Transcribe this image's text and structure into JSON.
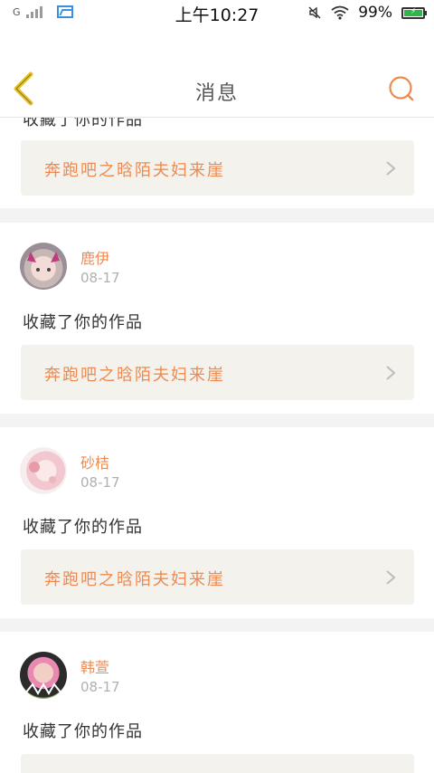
{
  "status": {
    "carrier": "G",
    "time": "上午10:27",
    "battery_text": "99%",
    "battery_level": 0.99
  },
  "header": {
    "title": "消息",
    "back_label": "返回",
    "search_label": "搜索"
  },
  "top_partial": {
    "action": "收藏了你的作品",
    "work_title": "奔跑吧之晗陌夫妇来崖"
  },
  "notifications": [
    {
      "username": "鹿伊",
      "date": "08-17",
      "action": "收藏了你的作品",
      "work_title": "奔跑吧之晗陌夫妇来崖"
    },
    {
      "username": "砂桔",
      "date": "08-17",
      "action": "收藏了你的作品",
      "work_title": "奔跑吧之晗陌夫妇来崖"
    },
    {
      "username": "韩萱",
      "date": "08-17",
      "action": "收藏了你的作品",
      "work_title": ""
    }
  ],
  "colors": {
    "accent": "#f0894e",
    "back_arrow": "#e8c32c",
    "work_box_bg": "#f3f2ed",
    "divider": "#f3f3f3"
  }
}
